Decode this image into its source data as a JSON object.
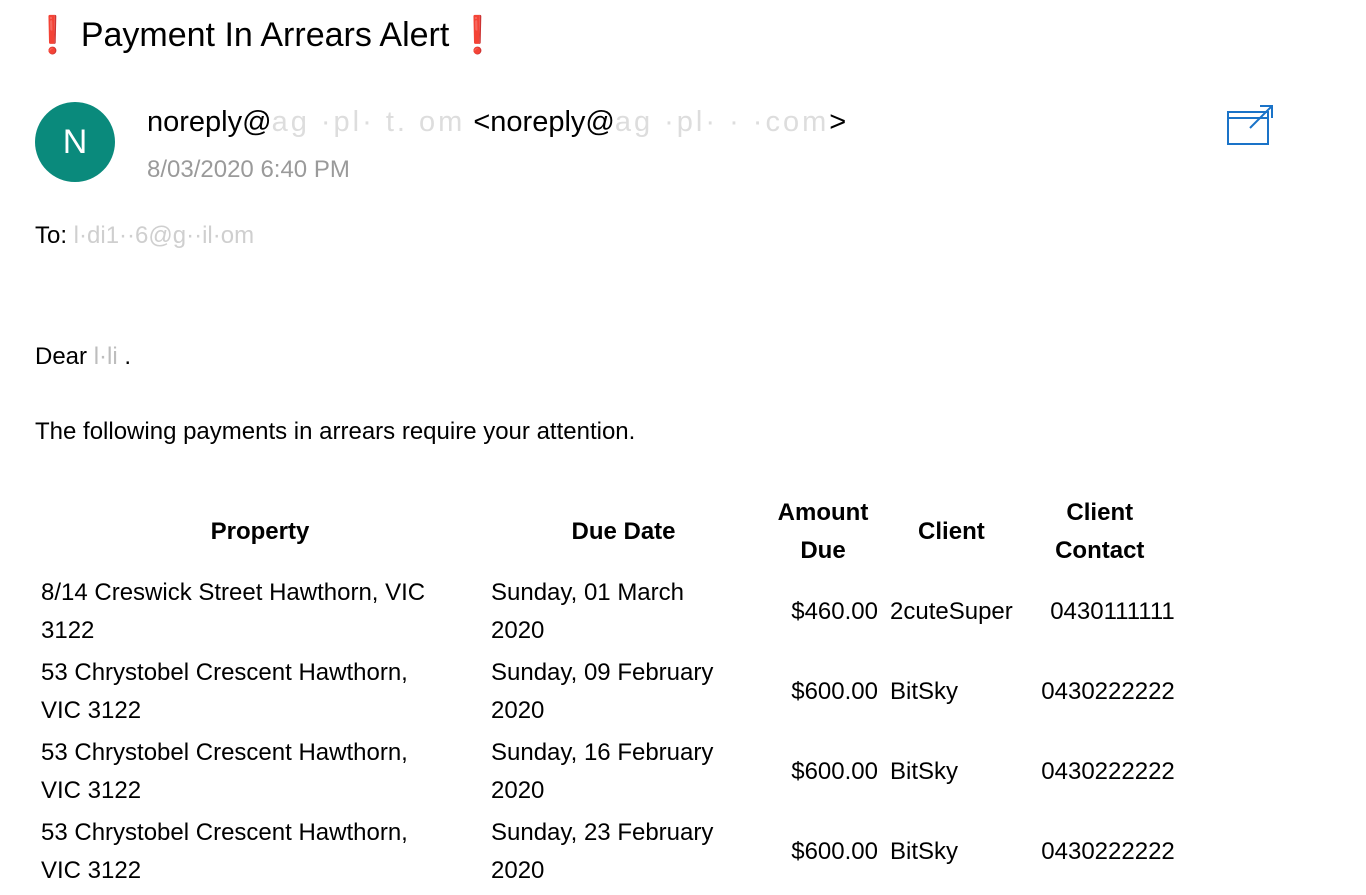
{
  "email": {
    "subject_mark_left": "❗",
    "subject": "Payment In Arrears Alert",
    "subject_mark_right": "❗",
    "avatar_initial": "N",
    "sender_name": "noreply@",
    "sender_name_redacted": "ag  ·pl·   t.  om",
    "sender_bracket_open": " <noreply@",
    "sender_email_redacted": "ag  ·pl·  ·    ·com",
    "sender_bracket_close": ">",
    "timestamp_redacted": "8/03/2020 6:40 PM",
    "to_label": "To:",
    "to_redacted": " l·di1··6@g··il·om",
    "greeting": "Dear",
    "greeting_redacted": " l·li",
    "greeting_end": " .",
    "intro": "The following payments in arrears require your attention."
  },
  "table": {
    "headers": {
      "property": "Property",
      "due_date": "Due Date",
      "amount_due_1": "Amount",
      "amount_due_2": "Due",
      "client": "Client",
      "client_contact_1": "Client",
      "client_contact_2": "Contact"
    },
    "rows": [
      {
        "property_1": "8/14 Creswick Street Hawthorn, VIC",
        "property_2": "3122",
        "date_1": "Sunday, 01 March",
        "date_2": "2020",
        "amount": "$460.00",
        "client": "2cuteSuper",
        "contact": "0430111111"
      },
      {
        "property_1": "53 Chrystobel Crescent Hawthorn,",
        "property_2": "VIC 3122",
        "date_1": "Sunday, 09 February",
        "date_2": "2020",
        "amount": "$600.00",
        "client": "BitSky",
        "contact": "0430222222"
      },
      {
        "property_1": "53 Chrystobel Crescent Hawthorn,",
        "property_2": "VIC 3122",
        "date_1": "Sunday, 16 February",
        "date_2": "2020",
        "amount": "$600.00",
        "client": "BitSky",
        "contact": "0430222222"
      },
      {
        "property_1": "53 Chrystobel Crescent Hawthorn,",
        "property_2": "VIC 3122",
        "date_1": "Sunday, 23 February",
        "date_2": "2020",
        "amount": "$600.00",
        "client": "BitSky",
        "contact": "0430222222"
      }
    ]
  },
  "icons": {
    "popout": "open-in-new-window-icon"
  },
  "colors": {
    "avatar_bg": "#0a8a7c",
    "alert_mark": "#d83a2e",
    "popout_icon": "#1a73c8"
  }
}
